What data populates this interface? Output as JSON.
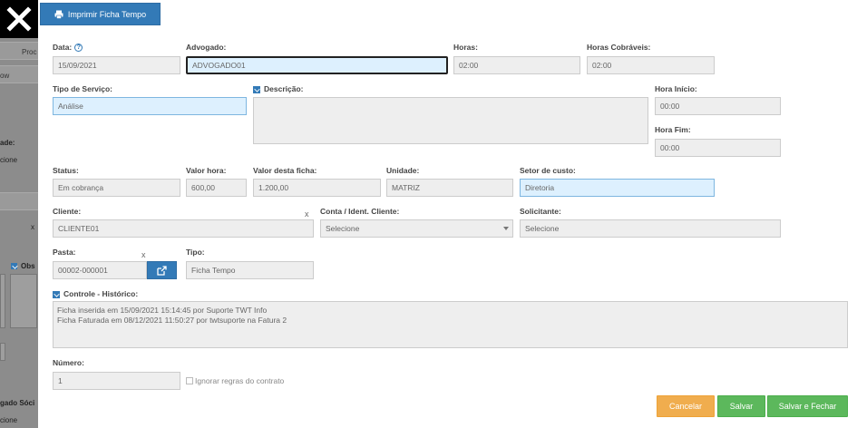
{
  "background": {
    "strip1": "Proc",
    "strip2": "ow",
    "text1": "ade:",
    "text2": "cione",
    "text3": "x",
    "text4": "Obs",
    "text5": "gado Sóci",
    "text6": "cione"
  },
  "toolbar": {
    "print_label": "Imprimir Ficha Tempo"
  },
  "form": {
    "data": {
      "label": "Data:",
      "value": "15/09/2021"
    },
    "advogado": {
      "label": "Advogado:",
      "value": "ADVOGADO01"
    },
    "horas": {
      "label": "Horas:",
      "value": "02:00"
    },
    "horas_cobraveis": {
      "label": "Horas Cobráveis:",
      "value": "02:00"
    },
    "tipo_servico": {
      "label": "Tipo de Serviço:",
      "value": "Análise"
    },
    "descricao": {
      "label": "Descrição:",
      "value": ""
    },
    "hora_inicio": {
      "label": "Hora Início:",
      "value": "00:00"
    },
    "hora_fim": {
      "label": "Hora Fim:",
      "value": "00:00"
    },
    "status": {
      "label": "Status:",
      "value": "Em cobrança"
    },
    "valor_hora": {
      "label": "Valor hora:",
      "value": "600,00"
    },
    "valor_ficha": {
      "label": "Valor desta ficha:",
      "value": "1.200,00"
    },
    "unidade": {
      "label": "Unidade:",
      "value": "MATRIZ"
    },
    "setor_custo": {
      "label": "Setor de custo:",
      "value": "Diretoria"
    },
    "cliente": {
      "label": "Cliente:",
      "value": "CLIENTE01",
      "clear": "x"
    },
    "conta": {
      "label": "Conta / Ident. Cliente:",
      "value": "Selecione"
    },
    "solicitante": {
      "label": "Solicitante:",
      "value": "Selecione"
    },
    "pasta": {
      "label": "Pasta:",
      "value": "00002-000001",
      "clear": "x"
    },
    "tipo": {
      "label": "Tipo:",
      "value": "Ficha Tempo"
    },
    "historico": {
      "label": "Controle - Histórico:",
      "lines": [
        "Ficha inserida em 15/09/2021 15:14:45 por Suporte TWT Info",
        "Ficha Faturada em 08/12/2021 11:50:27 por twtsuporte na Fatura 2"
      ]
    },
    "numero": {
      "label": "Número:",
      "value": "1"
    },
    "ignorar_label": "Ignorar regras do contrato"
  },
  "footer": {
    "cancel_label": "Cancelar",
    "save_label": "Salvar",
    "save_close_label": "Salvar e Fechar"
  },
  "colors": {
    "primary": "#337ab7",
    "warning": "#f0ad4e",
    "success": "#5cb85c",
    "highlight": "#ddf0fe"
  }
}
